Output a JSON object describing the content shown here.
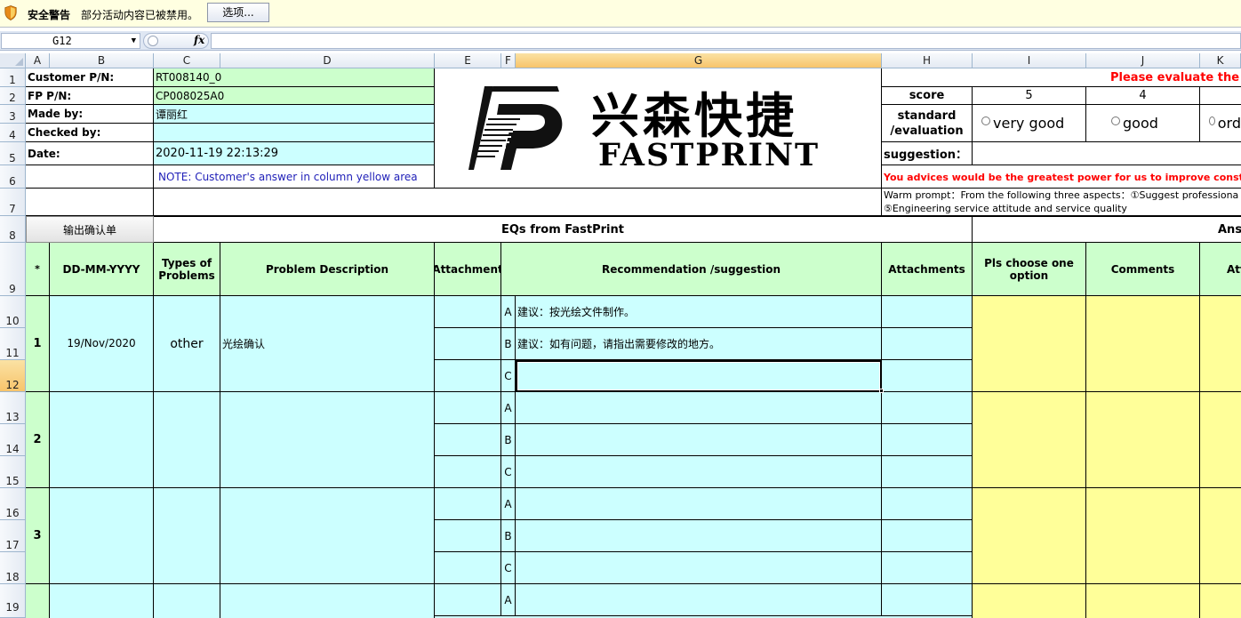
{
  "security_bar": {
    "title": "安全警告",
    "message": "部分活动内容已被禁用。",
    "options_button": "选项..."
  },
  "formula_bar": {
    "name_box": "G12",
    "fx_label": "fx",
    "content": ""
  },
  "column_headers": [
    "A",
    "B",
    "C",
    "D",
    "E",
    "F",
    "G",
    "H",
    "I",
    "J",
    "K"
  ],
  "selected_column": "G",
  "row_headers": [
    "1",
    "2",
    "3",
    "4",
    "5",
    "6",
    "7",
    "8",
    "9",
    "10",
    "11",
    "12",
    "13",
    "14",
    "15",
    "16",
    "17",
    "18",
    "19"
  ],
  "selected_row": "12",
  "header_info": {
    "customer_pn_label": "Customer P/N:",
    "customer_pn_value": "RT008140_0",
    "fp_pn_label": "FP P/N:",
    "fp_pn_value": "CP008025A0",
    "made_by_label": "Made by:",
    "made_by_value": "谭丽红",
    "checked_by_label": "Checked by:",
    "checked_by_value": "",
    "date_label": "Date:",
    "date_value": "2020-11-19 22:13:29",
    "note": "NOTE: Customer's  answer in column yellow area"
  },
  "logo": {
    "chinese": "兴森快捷",
    "english": "FASTPRINT"
  },
  "evaluation": {
    "title": "Please evaluate the e",
    "score_label": "score",
    "scores": [
      "5",
      "4"
    ],
    "standard_label_1": "standard",
    "standard_label_2": "/evaluation",
    "options": [
      "very good",
      "good",
      "ord"
    ],
    "suggestion_label": "suggestion：",
    "advice": "You advices would be the greatest power for us to improve constantly，",
    "warm_prompt_1": "Warm prompt：From the following three aspects：①Suggest professiona",
    "warm_prompt_2": "⑤Engineering service attitude and service quality"
  },
  "output_button": "输出确认单",
  "section_titles": {
    "eqs": "EQs from FastPrint",
    "answers": "Ans"
  },
  "table_headers": {
    "star": "*",
    "date": "DD-MM-YYYY",
    "types": "Types of Problems",
    "problem": "Problem Description",
    "attachment": "Attachment",
    "recommendation": "Recommendation /suggestion",
    "attachments": "Attachments",
    "choose": "Pls choose one option",
    "comments": "Comments",
    "att": "Att"
  },
  "rows": [
    {
      "no": "1",
      "date": "19/Nov/2020",
      "type": "other",
      "problem": "光绘确认",
      "options": [
        {
          "letter": "A",
          "text": "建议：按光绘文件制作。"
        },
        {
          "letter": "B",
          "text": "建议：如有问题，请指出需要修改的地方。"
        },
        {
          "letter": "C",
          "text": ""
        }
      ]
    },
    {
      "no": "2",
      "date": "",
      "type": "",
      "problem": "",
      "options": [
        {
          "letter": "A",
          "text": ""
        },
        {
          "letter": "B",
          "text": ""
        },
        {
          "letter": "C",
          "text": ""
        }
      ]
    },
    {
      "no": "3",
      "date": "",
      "type": "",
      "problem": "",
      "options": [
        {
          "letter": "A",
          "text": ""
        },
        {
          "letter": "B",
          "text": ""
        },
        {
          "letter": "C",
          "text": ""
        }
      ]
    },
    {
      "no": "",
      "date": "",
      "type": "",
      "problem": "",
      "options": [
        {
          "letter": "A",
          "text": ""
        }
      ]
    }
  ],
  "colors": {
    "green_cell": "#ccffcc",
    "cyan_cell": "#ccffff",
    "yellow_cell": "#ffff99",
    "red_text": "#ff0000",
    "note_blue": "#1f1fb8",
    "header_select": "#f7c46b"
  },
  "icons": {
    "security": "shield-icon",
    "dropdown": "chevron-down-icon"
  }
}
